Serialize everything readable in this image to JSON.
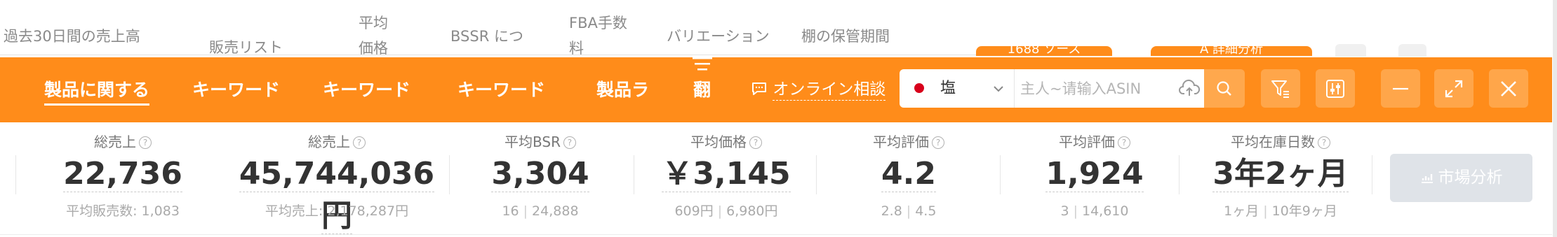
{
  "background_columns": [
    {
      "label": "過去30日間の売上高"
    },
    {
      "label": "販売リスト"
    },
    {
      "label": "平均価格"
    },
    {
      "label": "BSSR につ"
    },
    {
      "label": "FBA手数料"
    },
    {
      "label": "バリエーション"
    },
    {
      "label": "棚の保管期間"
    }
  ],
  "background_pills": [
    {
      "label": "1688 ソース"
    },
    {
      "label": "A 詳細分析"
    }
  ],
  "toolbar": {
    "tabs": [
      {
        "label": "製品に関する",
        "active": true
      },
      {
        "label": "キーワード"
      },
      {
        "label": "キーワード"
      },
      {
        "label": "キーワード"
      },
      {
        "label": "製品ラ"
      }
    ],
    "menu_label": "翻",
    "consult_label": "オンライン相談",
    "market_label": "塩",
    "asin_placeholder": "主人~请输入ASIN",
    "colors": {
      "accent": "#ff8c1a",
      "button": "#ffa64a",
      "flag": "#d8001b"
    }
  },
  "stats": [
    {
      "title": "総売上",
      "value": "22,736",
      "sub_label": "平均販売数:",
      "sub_value": "1,083"
    },
    {
      "title": "総売上",
      "value": "45,744,036円",
      "sub_label": "平均売上:",
      "sub_value": "2,178,287円"
    },
    {
      "title": "平均BSR",
      "value": "3,304",
      "sub_min": "16",
      "sub_max": "24,888"
    },
    {
      "title": "平均価格",
      "value": "￥3,145",
      "sub_min": "609円",
      "sub_max": "6,980円"
    },
    {
      "title": "平均評価",
      "value": "4.2",
      "sub_min": "2.8",
      "sub_max": "4.5"
    },
    {
      "title": "平均評価",
      "value": "1,924",
      "sub_min": "3",
      "sub_max": "14,610"
    },
    {
      "title": "平均在庫日数",
      "value": "3年2ヶ月",
      "sub_min": "1ヶ月",
      "sub_max": "10年9ヶ月"
    }
  ],
  "market_analysis_label": "市場分析",
  "icons": [
    "filter-icon",
    "adjust-icon",
    "minimize-icon",
    "expand-icon",
    "close-icon",
    "search-icon",
    "upload-icon",
    "chat-icon",
    "menu-icon",
    "help-icon",
    "chart-icon"
  ]
}
